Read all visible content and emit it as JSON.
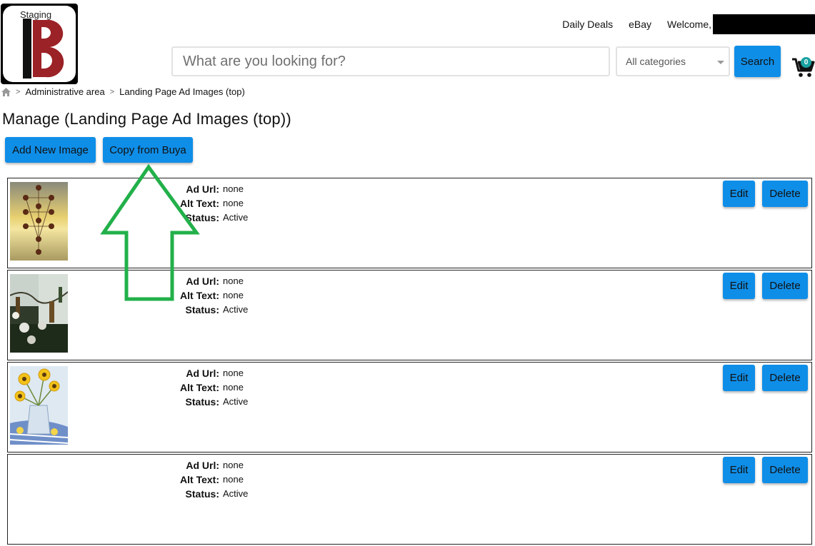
{
  "header": {
    "logo_label": "Staging",
    "nav": {
      "daily_deals": "Daily Deals",
      "ebay": "eBay",
      "welcome": "Welcome,"
    },
    "search": {
      "placeholder": "What are you looking for?",
      "category_value": "All categories",
      "button_label": "Search"
    },
    "cart": {
      "count": "0",
      "icon": "cart-icon"
    }
  },
  "breadcrumb": {
    "home_icon": "home-icon",
    "items": [
      "Administrative area",
      "Landing Page Ad Images (top)"
    ]
  },
  "page": {
    "title": "Manage (Landing Page Ad Images (top))",
    "add_button": "Add New Image",
    "copy_button": "Copy from Buya"
  },
  "ads": [
    {
      "thumbnail": "tree-of-life-artwork",
      "ad_url_label": "Ad Url:",
      "ad_url": "none",
      "alt_text_label": "Alt Text:",
      "alt_text": "none",
      "status_label": "Status:",
      "status": "Active",
      "edit_label": "Edit",
      "delete_label": "Delete"
    },
    {
      "thumbnail": "hanging-bottles-artwork",
      "ad_url_label": "Ad Url:",
      "ad_url": "none",
      "alt_text_label": "Alt Text:",
      "alt_text": "none",
      "status_label": "Status:",
      "status": "Active",
      "edit_label": "Edit",
      "delete_label": "Delete"
    },
    {
      "thumbnail": "sunflowers-watercolor",
      "ad_url_label": "Ad Url:",
      "ad_url": "none",
      "alt_text_label": "Alt Text:",
      "alt_text": "none",
      "status_label": "Status:",
      "status": "Active",
      "edit_label": "Edit",
      "delete_label": "Delete"
    },
    {
      "thumbnail": "",
      "ad_url_label": "Ad Url:",
      "ad_url": "none",
      "alt_text_label": "Alt Text:",
      "alt_text": "none",
      "status_label": "Status:",
      "status": "Active",
      "edit_label": "Edit",
      "delete_label": "Delete"
    }
  ],
  "annotation": {
    "icon": "up-arrow-icon",
    "color": "#22b04a"
  },
  "colors": {
    "primary_button": "#0f8ee8",
    "logo_red": "#9b2226",
    "cart_badge": "#1aa1a1"
  }
}
